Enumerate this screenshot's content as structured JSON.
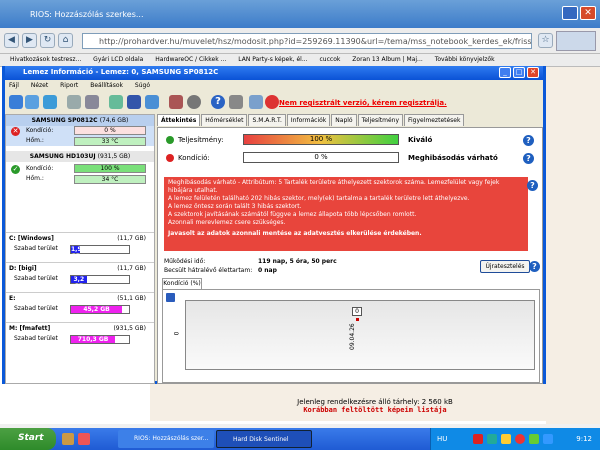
{
  "browser": {
    "title": "RIOS: Hozzászólás szerkes...",
    "url": "http://prohardver.hu/muvelet/hsz/modosit.php?id=259269.11390&url=/tema/mss_notebook_kerdes_ek/friss.html",
    "bookmarks": [
      "Hivatkozások testresz...",
      "Gyári LCD oldala",
      "HardwareOC / Cikkek ...",
      "LAN Party-s képek, él...",
      "cuccok",
      "Zoran 13 Album | Maj...",
      "További könyvjelzők"
    ],
    "footer_line1": "Jelenleg rendelkezésre álló tárhely: 2 560 kB",
    "footer_line2": "Korábban feltöltött képeim listája"
  },
  "app": {
    "title": "Lemez Információ - Lemez: 0, SAMSUNG SP0812C",
    "menu": [
      "Fájl",
      "Nézet",
      "Riport",
      "Beállítások",
      "Súgó"
    ],
    "warning": "Nem regisztrált verzió, kérem regisztrálja."
  },
  "disks": [
    {
      "name": "SAMSUNG SP0812C",
      "size": "(74,6 GB)",
      "health_label": "Kondíció:",
      "health": "0 %",
      "temp_label": "Hőm.:",
      "temp": "33 °C",
      "status": "error"
    },
    {
      "name": "SAMSUNG HD103UJ",
      "size": "(931,5 GB)",
      "health_label": "Kondíció:",
      "health": "100 %",
      "temp_label": "Hőm.:",
      "temp": "34 °C",
      "status": "ok"
    }
  ],
  "volumes": [
    {
      "name": "C: [Windows]",
      "size": "(11,7 GB)",
      "free_label": "Szabad terület",
      "free": "1,9 GB",
      "color": "#2222ee",
      "fill_pct": 16
    },
    {
      "name": "D: [bigi]",
      "size": "(11,7 GB)",
      "free_label": "Szabad terület",
      "free": "3,2 GB",
      "color": "#2222ee",
      "fill_pct": 27
    },
    {
      "name": "E:",
      "size": "(51,1 GB)",
      "free_label": "Szabad terület",
      "free": "45,2 GB",
      "color": "#ee22ee",
      "fill_pct": 88
    },
    {
      "name": "M: [fmafett]",
      "size": "(931,5 GB)",
      "free_label": "Szabad terület",
      "free": "710,3 GB",
      "color": "#ee22ee",
      "fill_pct": 76
    }
  ],
  "tabs": [
    "Áttekintés",
    "Hőmérséklet",
    "S.M.A.R.T.",
    "Információk",
    "Napló",
    "Teljesítmény",
    "Figyelmeztetések"
  ],
  "overview": {
    "perf_label": "Teljesítmény:",
    "perf_value": "100 %",
    "perf_text": "Kiváló",
    "health_label": "Kondíció:",
    "health_value": "0 %",
    "health_text": "Meghibásodás várható",
    "alert_lines": [
      "Meghibásodás várható - Attribútum: 5 Tartalék területre áthelyezett szektorok száma. Lemezfelület vagy fejek",
      "hibájára utalhat.",
      "A lemez felületén található 202 hibás szektor, mely(ek) tartalma a tartalék területre lett áthelyezve.",
      "A lemez öntesz során talált 3 hibás szektort.",
      "A szektorok javításának számától függve a lemez állapota több lépcsőben romlott.",
      "Azonnali merevlemez csere szükséges."
    ],
    "alert_bold": "Javasolt az adatok azonnali mentése az adatvesztés elkerülése érdekében.",
    "uptime_label": "Működési idő:",
    "uptime": "119 nap, 5 óra, 50 perc",
    "remaining_label": "Becsült hátralévő élettartam:",
    "remaining": "0 nap",
    "retest_label": "Újratesztelés",
    "subtab": "Kondíció (%)",
    "graph": {
      "y_tick": "0",
      "point_label": "0",
      "x_label": "09.04.26"
    }
  },
  "taskbar": {
    "start": "Start",
    "tasks": [
      "RIOS: Hozzászólás szer...",
      "Hard Disk Sentinel"
    ],
    "lang": "HU",
    "clock": "9:12"
  }
}
